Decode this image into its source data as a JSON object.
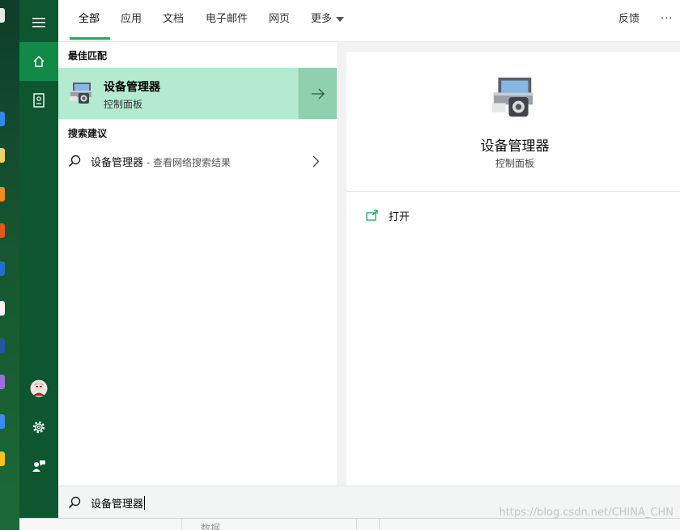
{
  "tabs": [
    {
      "label": "全部",
      "active": true
    },
    {
      "label": "应用"
    },
    {
      "label": "文档"
    },
    {
      "label": "电子邮件"
    },
    {
      "label": "网页"
    },
    {
      "label": "更多"
    }
  ],
  "topbar": {
    "feedback": "反馈",
    "more_options": "···"
  },
  "results": {
    "best_match_heading": "最佳匹配",
    "best_match": {
      "title": "设备管理器",
      "subtitle": "控制面板",
      "icon": "device-manager-icon"
    },
    "suggestions_heading": "搜索建议",
    "suggestion": {
      "text": "设备管理器",
      "hint": " - 查看网络搜索结果",
      "icon": "search-icon"
    }
  },
  "preview": {
    "title": "设备管理器",
    "subtitle": "控制面板",
    "actions": [
      {
        "label": "打开",
        "icon": "open-icon"
      }
    ]
  },
  "search": {
    "query": "设备管理器"
  },
  "background": {
    "partial_text": "数据"
  },
  "watermark": "https://blog.csdn.net/CHINA_CHN",
  "colors": {
    "sidebar": "#0d5630",
    "accent": "#10b35a",
    "selected_row": "#b4ebd0",
    "arrow_block": "#8fd0ae"
  }
}
